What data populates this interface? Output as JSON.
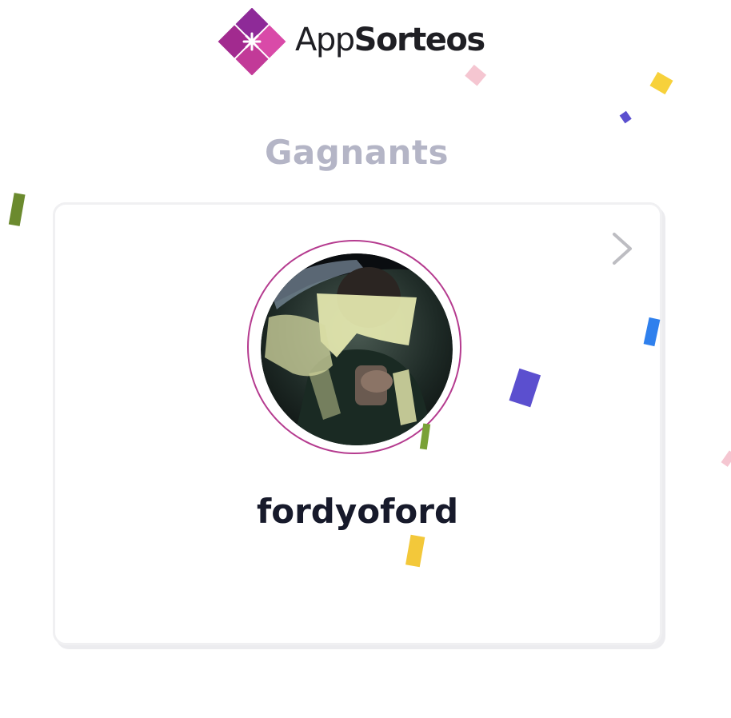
{
  "header": {
    "brand_prefix": "App",
    "brand_suffix": "Sorteos",
    "logo_icon": "appsorteos-logo-icon"
  },
  "title": "Gagnants",
  "winner": {
    "username": "fordyoford",
    "avatar_icon": "winner-avatar-photo",
    "next_icon": "chevron-right-icon"
  },
  "colors": {
    "brand_purple": "#8e2a98",
    "brand_pink": "#e04ba7",
    "avatar_ring": "#b53b8f",
    "title_gray": "#b4b5c6",
    "name_dark": "#171a2b",
    "confetti": [
      "#6b8a2e",
      "#f5c6d1",
      "#f7d13b",
      "#5b4fcf",
      "#2f80ed",
      "#79a136",
      "#f3c83a"
    ]
  }
}
